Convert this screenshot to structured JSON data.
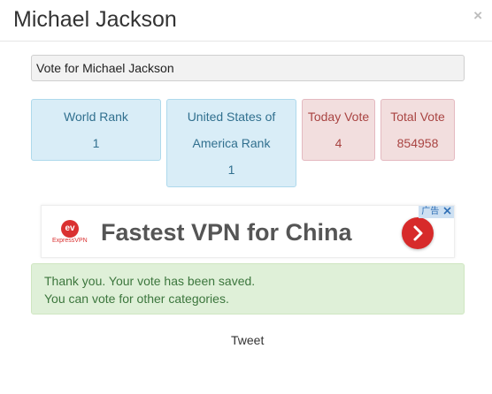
{
  "header": {
    "title": "Michael Jackson",
    "close_label": "×"
  },
  "vote_field": {
    "value": "Vote for Michael Jackson"
  },
  "stats": {
    "world_rank": {
      "label": "World Rank",
      "value": "1"
    },
    "country_rank": {
      "label": "United States of America Rank",
      "value": "1"
    },
    "today_vote": {
      "label": "Today Vote",
      "value": "4"
    },
    "total_vote": {
      "label": "Total Vote",
      "value": "854958"
    }
  },
  "ad": {
    "headline": "Fastest VPN for China",
    "badge": "广告",
    "logo_text": "ExpressVPN",
    "logo_mark": "ev"
  },
  "alert": {
    "line1": "Thank you. Your vote has been saved.",
    "line2": "You can vote for other categories."
  },
  "tweet_label": "Tweet",
  "colors": {
    "info_bg": "#d9edf7",
    "info_text": "#31708f",
    "danger_bg": "#f2dede",
    "danger_text": "#a94442",
    "success_bg": "#dff0d8",
    "success_text": "#3c763d",
    "ad_accent": "#d72a2a"
  }
}
